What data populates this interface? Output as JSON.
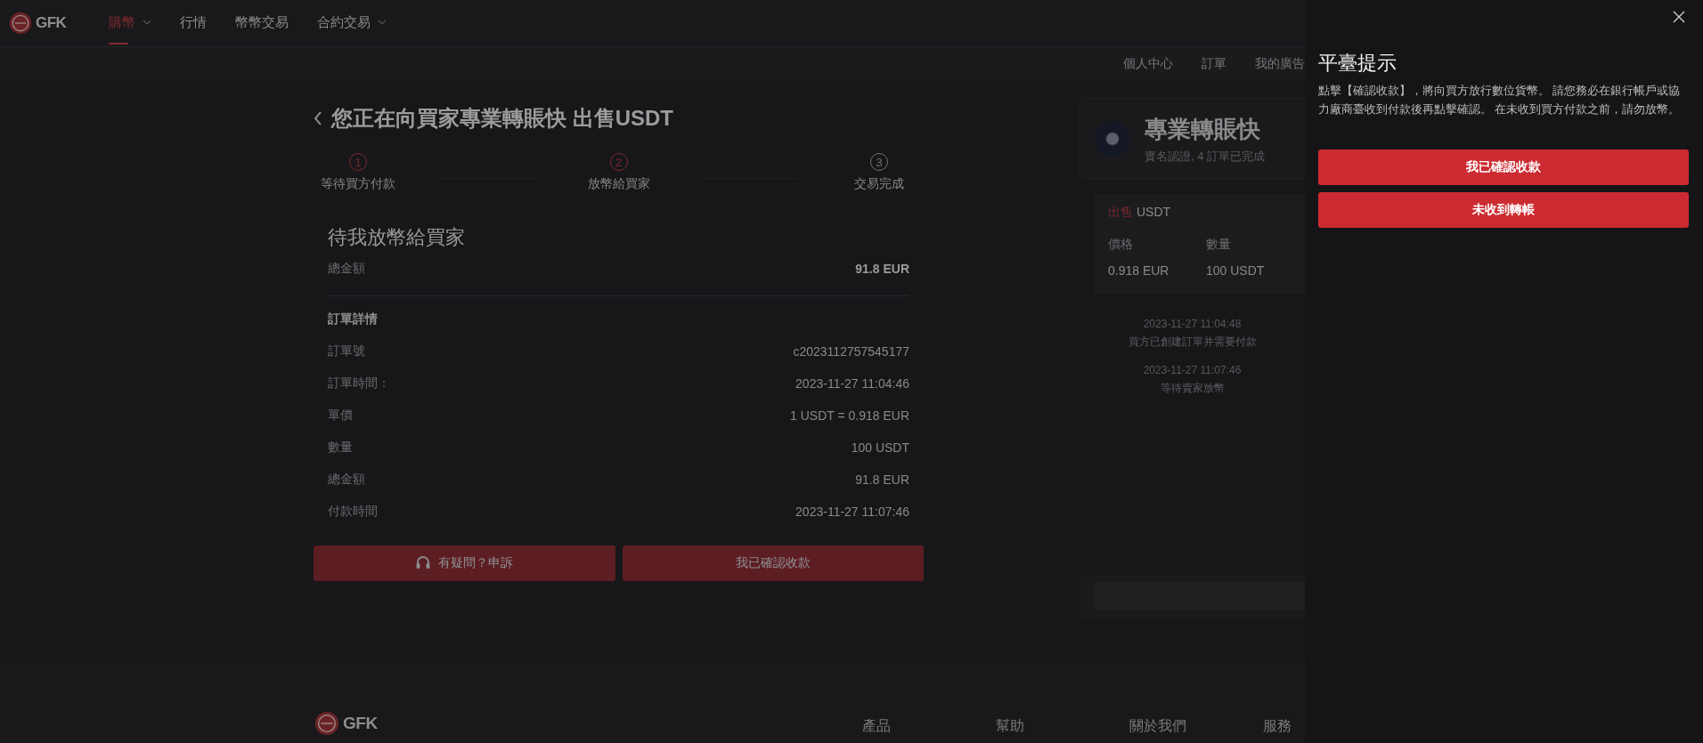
{
  "nav": {
    "logo": "GFK",
    "items": [
      {
        "label": "購幣",
        "selected": true,
        "dropdown": true
      },
      {
        "label": "行情",
        "selected": false,
        "dropdown": false
      },
      {
        "label": "幣幣交易",
        "selected": false,
        "dropdown": false
      },
      {
        "label": "合約交易",
        "selected": false,
        "dropdown": true
      }
    ]
  },
  "subnav": [
    "個人中心",
    "訂單",
    "我的廣告"
  ],
  "order": {
    "title": "您正在向買家專業轉賬快 出售USDT",
    "steps": [
      {
        "number": "1",
        "label": "等待買方付款",
        "active": true
      },
      {
        "number": "2",
        "label": "放幣給買家",
        "active": true
      },
      {
        "number": "3",
        "label": "交易完成",
        "active": false
      }
    ],
    "status_title": "待我放幣給買家",
    "total": {
      "label": "總金額",
      "value": "91.8 EUR"
    },
    "details_title": "訂單詳情",
    "details": [
      {
        "label": "訂單號",
        "value": "c2023112757545177"
      },
      {
        "label": "訂單時間：",
        "value": "2023-11-27 11:04:46"
      },
      {
        "label": "單價",
        "value": "1 USDT = 0.918 EUR"
      },
      {
        "label": "數量",
        "value": "100 USDT"
      },
      {
        "label": "總金額",
        "value": "91.8 EUR"
      },
      {
        "label": "付款時間",
        "value": "2023-11-27 11:07:46"
      }
    ],
    "buttons": [
      {
        "kind": "appeal",
        "label": "有疑問？申訴"
      },
      {
        "kind": "confirm",
        "label": "我已確認收款"
      }
    ]
  },
  "seller": {
    "name": "專業轉賬快",
    "meta": "實名認證, 4 訂單已完成"
  },
  "trade": {
    "side": "出售",
    "asset": "USDT",
    "columns": [
      {
        "label": "價格",
        "value": "0.918 EUR"
      },
      {
        "label": "數量",
        "value": "100 USDT"
      }
    ]
  },
  "timeline": [
    {
      "time": "2023-11-27 11:04:48",
      "text": "買方已創建訂單并需要付款"
    },
    {
      "time": "2023-11-27 11:07:46",
      "text": "等待賣家放幣"
    }
  ],
  "footer": {
    "logo": "GFK",
    "columns": [
      "產品",
      "幫助",
      "關於我們",
      "服務"
    ]
  },
  "drawer": {
    "title": "平臺提示",
    "message": "點擊【確認收款】，將向買方放行數位貨幣。 請您務必在銀行帳戶或協力廠商臺收到付款後再點擊確認。 在未收到買方付款之前，請勿放幣。",
    "buttons": [
      "我已確認收款",
      "未收到轉帳"
    ]
  }
}
